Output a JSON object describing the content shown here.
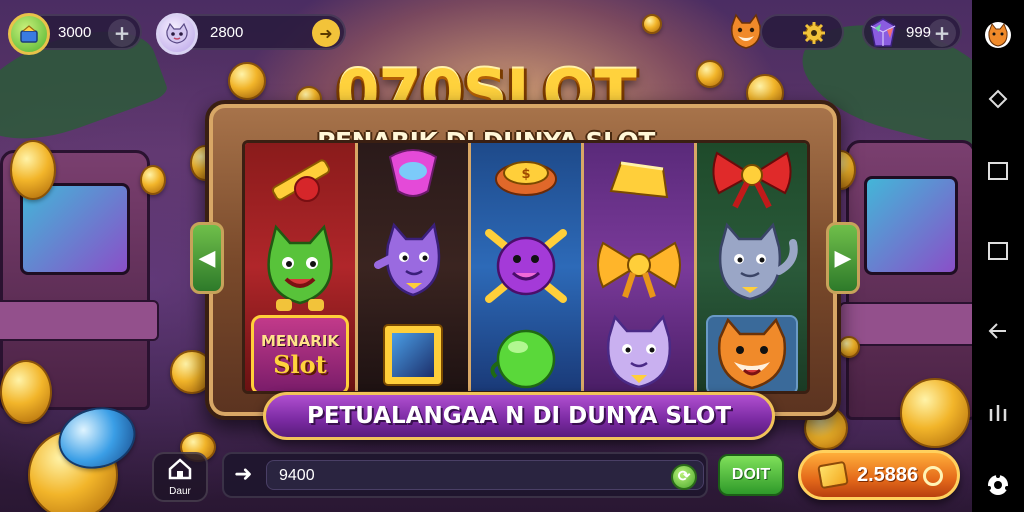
{
  "hud": {
    "left_balance": "3000",
    "left_add_icon": "plus-icon",
    "center_balance": "2800",
    "center_action_icon": "arrow-icon",
    "settings_icon": "gear-icon",
    "right_balance": "999",
    "right_add_icon": "plus-icon"
  },
  "title": "070SLOT",
  "subtitle": "PENARIK DI DUNYA SLOT",
  "reels": [
    [
      "golden-sword",
      "magic-gem",
      "menarik-slot-badge"
    ],
    [
      "purple-cat-top",
      "purple-cat-waving",
      "gold-frame"
    ],
    [
      "gold-coin-top",
      "purple-face-orb",
      "green-orb"
    ],
    [
      "gold-ingot",
      "gold-bow",
      "purple-cat"
    ],
    [
      "red-bow",
      "gray-cat",
      "orange-fox"
    ]
  ],
  "reel_badge": {
    "line1": "MENARIK",
    "line2": "Slot"
  },
  "banner": "PETUALANGAA N DI DUNYA SLOT",
  "bottom": {
    "home_label": "Daur",
    "bet_value": "9400",
    "go_label": "DOIT",
    "spin_value": "2.5886"
  },
  "colors": {
    "accent_gold": "#ffd23d",
    "banner_purple": "#7a2aa2",
    "spin_orange": "#e4691a",
    "go_green": "#2f9a2a"
  }
}
